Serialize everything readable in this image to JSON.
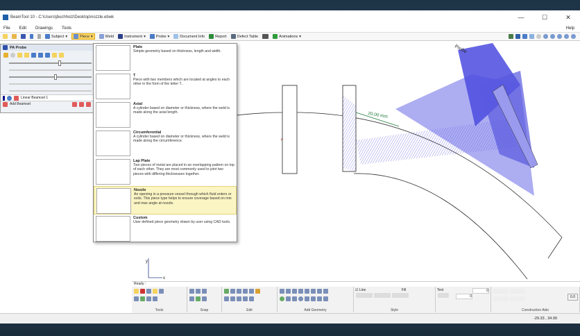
{
  "window": {
    "title": "BeamTool 10 - C:\\Users\\jbuchholz\\Desktop\\nozzle.ebwk",
    "minimize": "—",
    "maximize": "☐",
    "close": "✕"
  },
  "menu": [
    "File",
    "Edit",
    "Drawings",
    "Tools"
  ],
  "menu_help": "Help",
  "toolbar": {
    "subject": "Subject",
    "piece": "Piece",
    "weld": "Weld",
    "instrument": "Instrument",
    "probe": "Probe",
    "document_info": "Document Info",
    "report": "Report",
    "defect_table": "Defect Table",
    "animations": "Animations"
  },
  "left_panel": {
    "title": "PA Probe",
    "beamset": "Linear Beamset 1",
    "add_beamset": "Add Beamset",
    "sliders": [
      0.6,
      null,
      0.55,
      null,
      null
    ]
  },
  "piece_menu": [
    {
      "title": "Plate",
      "desc": "Simple geometry based on thickness, length and width."
    },
    {
      "title": "T",
      "desc": "Piece with two members which are located at angles to each other in the form of the letter T.."
    },
    {
      "title": "Axial",
      "desc": "A cylinder based on diameter or thickness, where the weld is made along the axial length."
    },
    {
      "title": "Circumferential",
      "desc": "A cylinder based on diameter or thickness, where the weld is made along the circumference."
    },
    {
      "title": "Lap Plate",
      "desc": "Two pieces of metal are placed in an overlapping pattern on top of each other. They are most commonly used to joint two pieces with differing thicknesses together."
    },
    {
      "title": "Nozzle",
      "desc": "An opening in a pressure vessel through which fluid enters or exits.  This piece type helps to ensure coverage based on min and max angle at nozzle.",
      "selected": true
    },
    {
      "title": "Custom",
      "desc": "User defined piece geometry drawn by user using CAD tools."
    }
  ],
  "canvas": {
    "dimension": "20.00 mm",
    "probe_label": "Probe",
    "axis_x": "x",
    "axis_y": "y"
  },
  "ribbon": {
    "status": "Ready :",
    "groups": [
      "Tools",
      "Snap",
      "Edit",
      "Add Geometry",
      "Style",
      "Construction Aids"
    ],
    "line": "Line",
    "fill": "Fill",
    "text": "Text",
    "value1": "0",
    "value2": "0",
    "angle": "0.0"
  },
  "statusbar": {
    "coords": "-29.33 , 34.99"
  },
  "colors": {
    "probe": "#5a5ae6",
    "accent": "#fbd56b"
  }
}
